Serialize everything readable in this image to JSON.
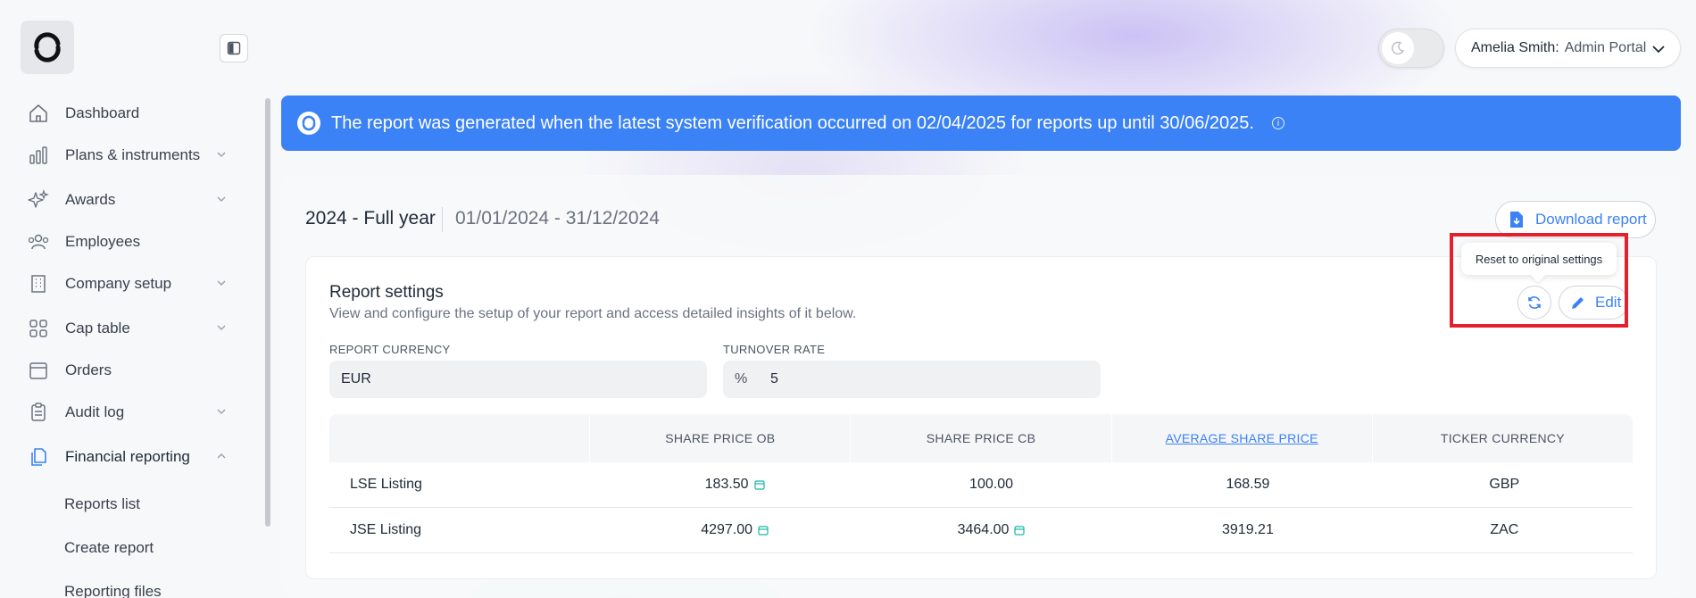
{
  "sidebar": {
    "items": [
      {
        "label": "Dashboard",
        "icon": "home-icon"
      },
      {
        "label": "Plans & instruments",
        "icon": "bar-chart-icon"
      },
      {
        "label": "Awards",
        "icon": "sparkles-icon"
      },
      {
        "label": "Employees",
        "icon": "users-icon"
      },
      {
        "label": "Company setup",
        "icon": "building-icon"
      },
      {
        "label": "Cap table",
        "icon": "grid-icon"
      },
      {
        "label": "Orders",
        "icon": "calendar-icon"
      },
      {
        "label": "Audit log",
        "icon": "clipboard-icon"
      },
      {
        "label": "Financial reporting",
        "icon": "documents-icon"
      }
    ],
    "subitems": [
      "Reports list",
      "Create report",
      "Reporting files"
    ]
  },
  "header": {
    "user_name": "Amelia Smith:",
    "portal": "Admin Portal"
  },
  "banner": {
    "text": "The report was generated when the latest system verification occurred on 02/04/2025 for reports up until 30/06/2025."
  },
  "report": {
    "title": "2024 - Full year",
    "range": "01/01/2024 - 31/12/2024",
    "download_label": "Download report"
  },
  "settings": {
    "title": "Report settings",
    "subtitle": "View and configure the setup of your report and access detailed insights of it below.",
    "tooltip": "Reset to original settings",
    "edit_label": "Edit",
    "currency_label": "REPORT CURRENCY",
    "currency_value": "EUR",
    "turnover_label": "TURNOVER RATE",
    "turnover_unit": "%",
    "turnover_value": "5"
  },
  "table": {
    "headers": [
      "",
      "SHARE PRICE OB",
      "SHARE PRICE CB",
      "AVERAGE SHARE PRICE",
      "TICKER CURRENCY"
    ],
    "rows": [
      [
        "LSE Listing",
        "183.50",
        "100.00",
        "168.59",
        "GBP"
      ],
      [
        "JSE Listing",
        "4297.00",
        "3464.00",
        "3919.21",
        "ZAC"
      ]
    ]
  },
  "colors": {
    "accent": "#3b82f6",
    "highlight": "#e5202e"
  }
}
